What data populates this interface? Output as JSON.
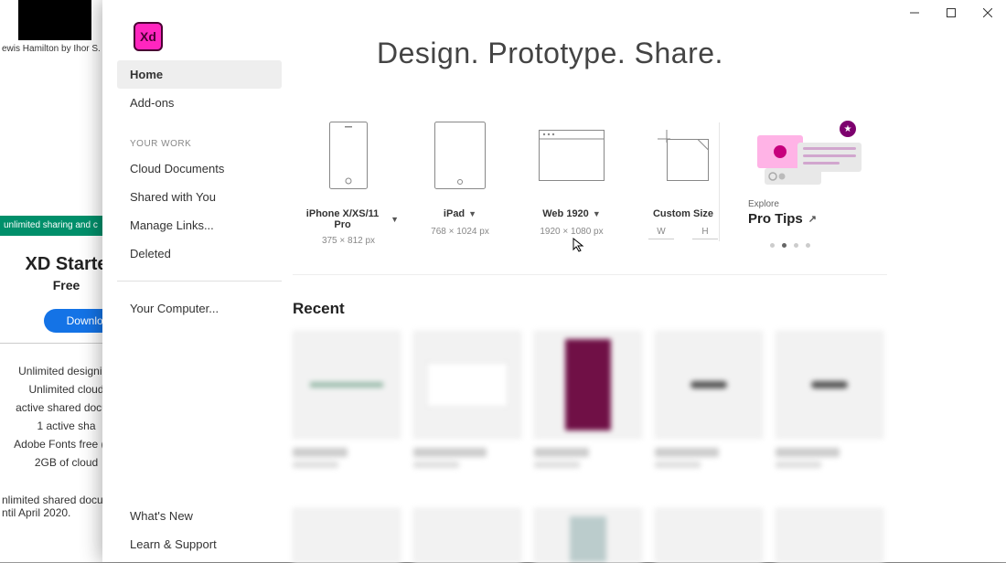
{
  "bg": {
    "caption": "ewis Hamilton by Ihor S.",
    "banner": "unlimited sharing and c",
    "title": "XD Starte",
    "subtitle": "Free",
    "download": "Downloa",
    "list": [
      "Unlimited designing",
      "Unlimited cloud",
      "active shared docum",
      "1 active sha",
      "Adobe Fonts free (lim",
      "2GB of cloud"
    ],
    "footer1": "nlimited shared docum",
    "footer2": "ntil April 2020."
  },
  "logo": "Xd",
  "headline": "Design. Prototype. Share.",
  "sidebar": {
    "home": "Home",
    "addons": "Add-ons",
    "work_heading": "YOUR WORK",
    "cloud": "Cloud Documents",
    "shared": "Shared with You",
    "manage": "Manage Links...",
    "deleted": "Deleted",
    "computer": "Your Computer...",
    "whatsnew": "What's New",
    "learn": "Learn & Support"
  },
  "presets": {
    "iphone": {
      "label": "iPhone X/XS/11 Pro",
      "dim": "375 × 812 px"
    },
    "ipad": {
      "label": "iPad",
      "dim": "768 × 1024 px"
    },
    "web": {
      "label": "Web 1920",
      "dim": "1920 × 1080 px"
    },
    "custom": {
      "label": "Custom Size",
      "w": "W",
      "h": "H"
    }
  },
  "tips": {
    "explore": "Explore",
    "title": "Pro Tips"
  },
  "recent_title": "Recent"
}
